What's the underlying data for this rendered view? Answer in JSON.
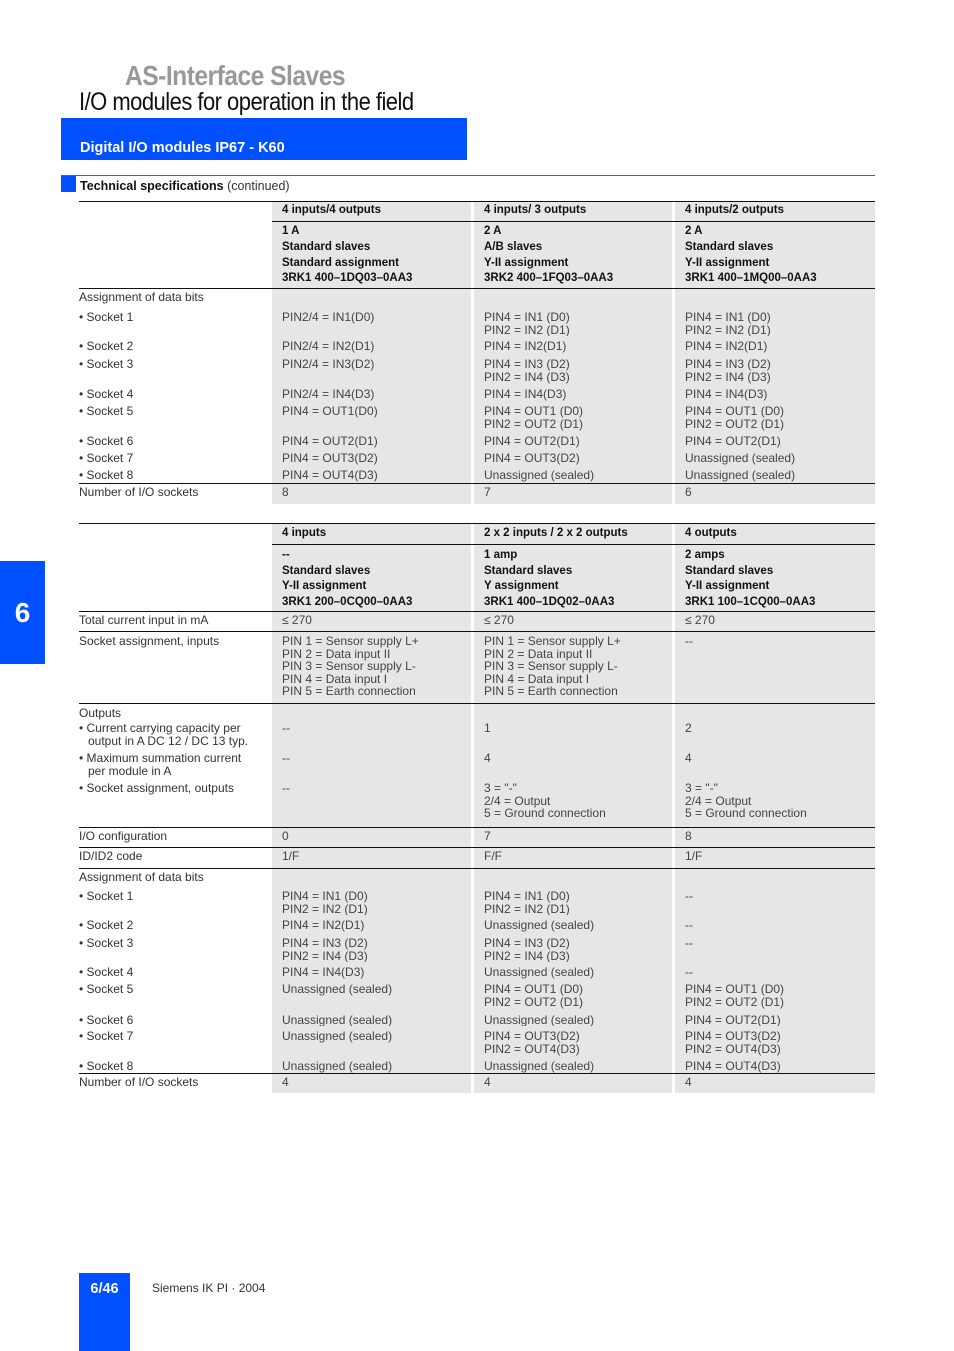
{
  "header": {
    "category": "AS-Interface Slaves",
    "title": "I/O modules for operation in the field",
    "banner": "Digital I/O modules IP67 - K60",
    "section_title": "Technical specifications",
    "section_suffix": "(continued)"
  },
  "side_tab": "6",
  "footer": {
    "page": "6/46",
    "publisher": "Siemens IK PI · 2004"
  },
  "table1": {
    "columns": [
      {
        "type": "4 inputs/4 outputs",
        "current": "1 A",
        "slaves": "Standard slaves",
        "assignment": "Standard assignment",
        "order_no": "3RK1 400–1DQ03–0AA3"
      },
      {
        "type": "4 inputs/ 3 outputs",
        "current": "2 A",
        "slaves": "A/B slaves",
        "assignment": "Y-II assignment",
        "order_no": "3RK2 400–1FQ03–0AA3"
      },
      {
        "type": "4 inputs/2 outputs",
        "current": "2 A",
        "slaves": "Standard slaves",
        "assignment": "Y-II assignment",
        "order_no": "3RK1 400–1MQ00–0AA3"
      }
    ],
    "assignment_label": "Assignment of data bits",
    "sockets": [
      {
        "label": "Socket 1",
        "values": [
          [
            "PIN2/4 = IN1(D0)"
          ],
          [
            "PIN4 = IN1 (D0)",
            "PIN2 = IN2 (D1)"
          ],
          [
            "PIN4 = IN1 (D0)",
            "PIN2 = IN2 (D1)"
          ]
        ]
      },
      {
        "label": "Socket 2",
        "values": [
          [
            "PIN2/4 = IN2(D1)"
          ],
          [
            "PIN4 = IN2(D1)"
          ],
          [
            "PIN4 = IN2(D1)"
          ]
        ]
      },
      {
        "label": "Socket 3",
        "values": [
          [
            "PIN2/4 = IN3(D2)"
          ],
          [
            "PIN4 = IN3 (D2)",
            "PIN2 = IN4 (D3)"
          ],
          [
            "PIN4 = IN3 (D2)",
            "PIN2 = IN4 (D3)"
          ]
        ]
      },
      {
        "label": "Socket 4",
        "values": [
          [
            "PIN2/4 = IN4(D3)"
          ],
          [
            "PIN4 = IN4(D3)"
          ],
          [
            "PIN4 = IN4(D3)"
          ]
        ]
      },
      {
        "label": "Socket 5",
        "values": [
          [
            "PIN4 = OUT1(D0)"
          ],
          [
            "PIN4 = OUT1 (D0)",
            "PIN2 = OUT2 (D1)"
          ],
          [
            "PIN4 = OUT1 (D0)",
            "PIN2 = OUT2 (D1)"
          ]
        ]
      },
      {
        "label": "Socket 6",
        "values": [
          [
            "PIN4 = OUT2(D1)"
          ],
          [
            "PIN4 = OUT2(D1)"
          ],
          [
            "PIN4 = OUT2(D1)"
          ]
        ]
      },
      {
        "label": "Socket 7",
        "values": [
          [
            "PIN4 = OUT3(D2)"
          ],
          [
            "PIN4 = OUT3(D2)"
          ],
          [
            "Unassigned (sealed)"
          ]
        ]
      },
      {
        "label": "Socket 8",
        "values": [
          [
            "PIN4 = OUT4(D3)"
          ],
          [
            "Unassigned (sealed)"
          ],
          [
            "Unassigned (sealed)"
          ]
        ]
      }
    ],
    "num_sockets_label": "Number of I/O sockets",
    "num_sockets": [
      "8",
      "7",
      "6"
    ]
  },
  "table2": {
    "columns": [
      {
        "type": "4 inputs",
        "current": "--",
        "slaves": "Standard slaves",
        "assignment": "Y-II assignment",
        "order_no": "3RK1 200–0CQ00–0AA3"
      },
      {
        "type": "2 x 2 inputs / 2 x 2 outputs",
        "current": "1 amp",
        "slaves": "Standard slaves",
        "assignment": "Y assignment",
        "order_no": "3RK1 400–1DQ02–0AA3"
      },
      {
        "type": "4 outputs",
        "current": "2 amps",
        "slaves": "Standard slaves",
        "assignment": "Y-II assignment",
        "order_no": "3RK1 100–1CQ00–0AA3"
      }
    ],
    "total_current_label": "Total current input in mA",
    "total_current": [
      "≤ 270",
      "≤ 270",
      "≤ 270"
    ],
    "socket_inputs_label": "Socket assignment, inputs",
    "socket_inputs": [
      [
        "PIN 1 = Sensor supply L+",
        "PIN 2 = Data input II",
        "PIN 3 = Sensor supply L-",
        "PIN 4 = Data input I",
        "PIN 5 = Earth connection"
      ],
      [
        "PIN 1 = Sensor supply L+",
        "PIN 2 = Data input II",
        "PIN 3 = Sensor supply L-",
        "PIN 4 = Data input I",
        "PIN 5 = Earth connection"
      ],
      [
        "--"
      ]
    ],
    "outputs_label": "Outputs",
    "current_capacity_label": [
      "Current carrying capacity per",
      "output in A DC 12 / DC 13 typ."
    ],
    "current_capacity": [
      "--",
      "1",
      "2"
    ],
    "max_current_label": [
      "Maximum summation current",
      "per module in A"
    ],
    "max_current": [
      "--",
      "4",
      "4"
    ],
    "socket_outputs_label": "Socket assignment, outputs",
    "socket_outputs": [
      [
        "--"
      ],
      [
        "3 = \"-\"",
        "2/4 = Output",
        "5 = Ground connection"
      ],
      [
        "3 = \"-\"",
        "2/4 = Output",
        "5 = Ground connection"
      ]
    ],
    "io_config_label": "I/O configuration",
    "io_config": [
      "0",
      "7",
      "8"
    ],
    "id_code_label": "ID/ID2 code",
    "id_code": [
      "1/F",
      "F/F",
      "1/F"
    ],
    "assignment_label": "Assignment of data bits",
    "sockets": [
      {
        "label": "Socket 1",
        "values": [
          [
            "PIN4 = IN1 (D0)",
            "PIN2 = IN2 (D1)"
          ],
          [
            "PIN4 = IN1 (D0)",
            "PIN2 = IN2 (D1)"
          ],
          [
            "--"
          ]
        ]
      },
      {
        "label": "Socket 2",
        "values": [
          [
            "PIN4 = IN2(D1)"
          ],
          [
            "Unassigned (sealed)"
          ],
          [
            "--"
          ]
        ]
      },
      {
        "label": "Socket 3",
        "values": [
          [
            "PIN4 = IN3 (D2)",
            "PIN2 = IN4 (D3)"
          ],
          [
            "PIN4 = IN3 (D2)",
            "PIN2 = IN4 (D3)"
          ],
          [
            "--"
          ]
        ]
      },
      {
        "label": "Socket 4",
        "values": [
          [
            "PIN4 = IN4(D3)"
          ],
          [
            "Unassigned (sealed)"
          ],
          [
            "--"
          ]
        ]
      },
      {
        "label": "Socket 5",
        "values": [
          [
            "Unassigned (sealed)"
          ],
          [
            "PIN4 = OUT1 (D0)",
            "PIN2 = OUT2 (D1)"
          ],
          [
            "PIN4 = OUT1 (D0)",
            "PIN2 = OUT2 (D1)"
          ]
        ]
      },
      {
        "label": "Socket 6",
        "values": [
          [
            "Unassigned (sealed)"
          ],
          [
            "Unassigned (sealed)"
          ],
          [
            "PIN4 = OUT2(D1)"
          ]
        ]
      },
      {
        "label": "Socket 7",
        "values": [
          [
            "Unassigned (sealed)"
          ],
          [
            "PIN4 = OUT3(D2)",
            "PIN2 = OUT4(D3)"
          ],
          [
            "PIN4 = OUT3(D2)",
            "PIN2 = OUT4(D3)"
          ]
        ]
      },
      {
        "label": "Socket 8",
        "values": [
          [
            "Unassigned (sealed)"
          ],
          [
            "Unassigned (sealed)"
          ],
          [
            "PIN4 = OUT4(D3)"
          ]
        ]
      }
    ],
    "num_sockets_label": "Number of I/O sockets",
    "num_sockets": [
      "4",
      "4",
      "4"
    ]
  }
}
